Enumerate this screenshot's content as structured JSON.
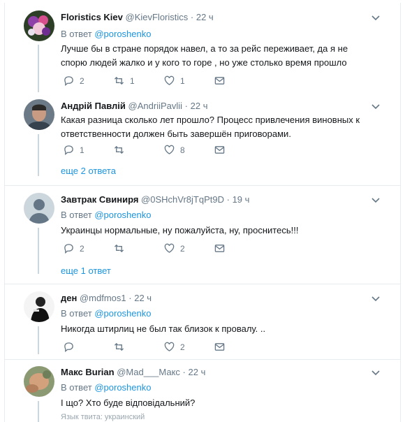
{
  "reply_prefix": "В ответ",
  "tweets": [
    {
      "name": "Floristics Kiev",
      "handle": "@KievFloristics",
      "time": "22 ч",
      "reply_to": "@poroshenko",
      "text": "Лучше бы в стране порядок навел, а то за рейс переживает, да я не спорю людей жалко и у кого то горе , но уже столько время прошло",
      "replies": "2",
      "retweets": "1",
      "likes": "1"
    },
    {
      "name": "Андрій Павлій",
      "handle": "@AndriiPavlii",
      "time": "22 ч",
      "text": "Какая разница сколько лет прошло? Процесс привлечения виновных к ответственности должен быть завершён приговорами.",
      "replies": "1",
      "retweets": "",
      "likes": "8",
      "more": "еще 2 ответа"
    },
    {
      "name": "Завтрак Свиниря",
      "handle": "@0SHchVr8jTqPt9D",
      "time": "19 ч",
      "reply_to": "@poroshenko",
      "text": "Украинцы нормальные, ну пожалуйста, ну, проснитесь!!!",
      "replies": "2",
      "retweets": "",
      "likes": "2",
      "more": "еще 1 ответ"
    },
    {
      "name": "ден",
      "handle": "@mdfmos1",
      "time": "22 ч",
      "reply_to": "@poroshenko",
      "text": "Никогда штирлиц не был так близок к провалу. ..",
      "replies": "",
      "retweets": "",
      "likes": "2"
    },
    {
      "name": "Макс Burian",
      "handle": "@Mad___Макс",
      "time": "22 ч",
      "reply_to": "@poroshenko",
      "text": "І що? Хто буде відповідальний?",
      "lang_note": "Язык твита: украинский"
    }
  ]
}
